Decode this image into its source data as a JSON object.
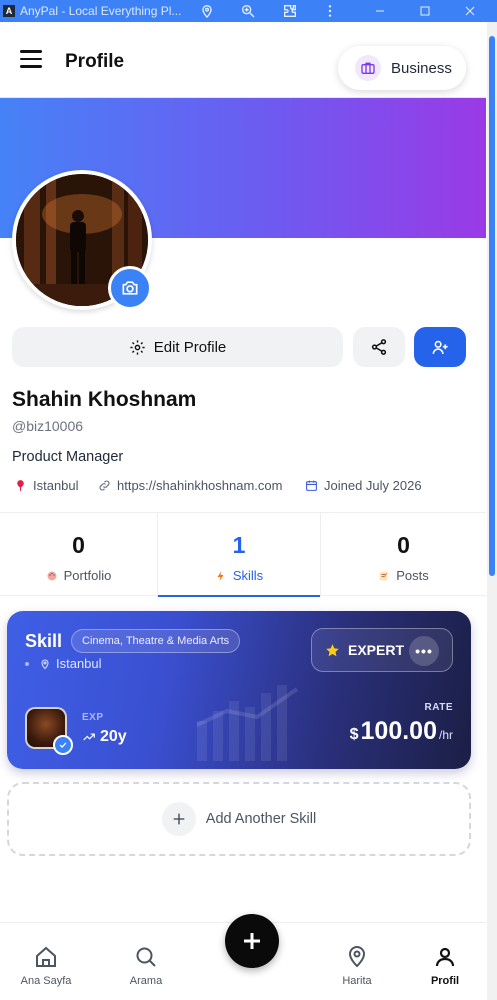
{
  "window": {
    "title": "AnyPal - Local Everything Pl...",
    "app_icon_letter": "A"
  },
  "header": {
    "title": "Profile",
    "business_label": "Business"
  },
  "actions": {
    "edit_label": "Edit Profile"
  },
  "profile": {
    "name": "Shahin Khoshnam",
    "handle": "@biz10006",
    "job": "Product Manager",
    "location": "Istanbul",
    "website": "https://shahinkhoshnam.com",
    "joined": "Joined July 2026"
  },
  "stats": [
    {
      "count": "0",
      "label": "Portfolio"
    },
    {
      "count": "1",
      "label": "Skills"
    },
    {
      "count": "0",
      "label": "Posts"
    }
  ],
  "skill_card": {
    "title": "Skill",
    "category": "Cinema, Theatre & Media Arts",
    "location": "Istanbul",
    "level": "EXPERT",
    "more": "•••",
    "exp_label": "EXP",
    "exp_value": "20y",
    "rate_label": "RATE",
    "currency": "$",
    "rate": "100.00",
    "rate_unit": "/hr"
  },
  "add_skill": {
    "label": "Add Another Skill"
  },
  "bottom_nav": [
    {
      "label": "Ana Sayfa"
    },
    {
      "label": "Arama"
    },
    {
      "label": "Harita"
    },
    {
      "label": "Profil"
    }
  ],
  "colors": {
    "accent": "#2563eb",
    "banner_start": "#4682f7",
    "banner_end": "#9a3ae6",
    "titlebar": "#3c82f6"
  }
}
